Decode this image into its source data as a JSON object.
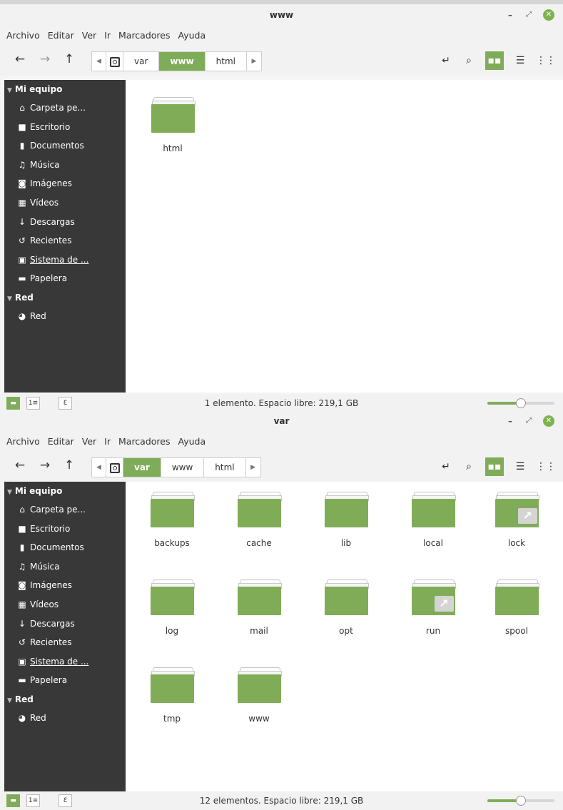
{
  "menu": [
    "Archivo",
    "Editar",
    "Ver",
    "Ir",
    "Marcadores",
    "Ayuda"
  ],
  "sidebar": {
    "section1": "Mi equipo",
    "items": [
      {
        "label": "Carpeta pe...",
        "icon": "home-icon"
      },
      {
        "label": "Escritorio",
        "icon": "desktop-icon"
      },
      {
        "label": "Documentos",
        "icon": "document-icon"
      },
      {
        "label": "Música",
        "icon": "music-icon"
      },
      {
        "label": "Imágenes",
        "icon": "camera-icon"
      },
      {
        "label": "Vídeos",
        "icon": "film-icon"
      },
      {
        "label": "Descargas",
        "icon": "download-icon"
      },
      {
        "label": "Recientes",
        "icon": "history-icon"
      },
      {
        "label": "Sistema de ...",
        "icon": "disk-icon"
      },
      {
        "label": "Papelera",
        "icon": "trash-icon"
      }
    ],
    "section2": "Red",
    "network": [
      {
        "label": "Red",
        "icon": "globe-icon"
      }
    ]
  },
  "colors": {
    "accent": "#7fac58",
    "sidebar_bg": "#383838",
    "close_button": "#7fb34f"
  },
  "window1": {
    "title": "www",
    "breadcrumb": [
      "var",
      "www",
      "html"
    ],
    "active_crumb": "www",
    "files": [
      {
        "name": "html",
        "symlink": false
      }
    ],
    "status": "1 elemento. Espacio libre: 219,1 GB",
    "zoom_level": 0.5
  },
  "window2": {
    "title": "var",
    "breadcrumb": [
      "var",
      "www",
      "html"
    ],
    "active_crumb": "var",
    "files": [
      {
        "name": "backups",
        "symlink": false
      },
      {
        "name": "cache",
        "symlink": false
      },
      {
        "name": "lib",
        "symlink": false
      },
      {
        "name": "local",
        "symlink": false
      },
      {
        "name": "lock",
        "symlink": true
      },
      {
        "name": "log",
        "symlink": false
      },
      {
        "name": "mail",
        "symlink": false
      },
      {
        "name": "opt",
        "symlink": false
      },
      {
        "name": "run",
        "symlink": true
      },
      {
        "name": "spool",
        "symlink": false
      },
      {
        "name": "tmp",
        "symlink": false
      },
      {
        "name": "www",
        "symlink": false
      }
    ],
    "status": "12 elementos. Espacio libre: 219,1 GB",
    "zoom_level": 0.5
  }
}
